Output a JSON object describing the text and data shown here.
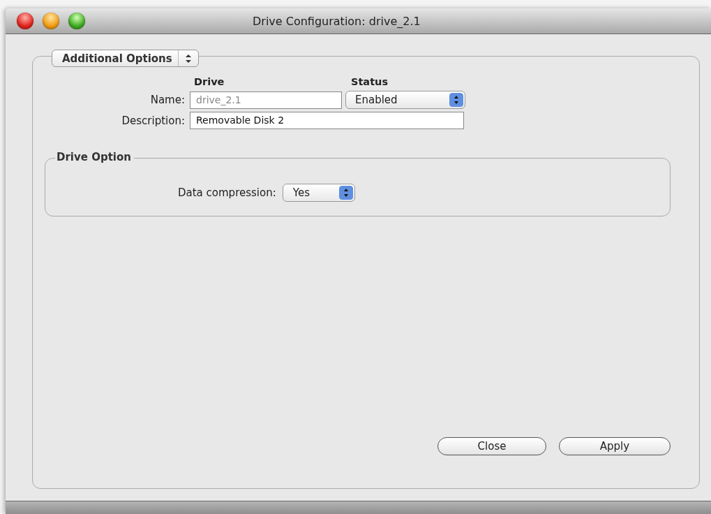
{
  "window": {
    "title": "Drive Configuration: drive_2.1"
  },
  "panel_selector": {
    "value": "Additional Options"
  },
  "columns": [
    "Drive",
    "Status"
  ],
  "name": {
    "label": "Name:",
    "value": "drive_2.1",
    "disabled": true
  },
  "status": {
    "value": "Enabled"
  },
  "description": {
    "label": "Description:",
    "value": "Removable Disk 2",
    "disabled": false
  },
  "drive_option": {
    "title": "Drive Option",
    "data_compression": {
      "label": "Data compression:",
      "value": "Yes"
    }
  },
  "buttons": [
    "Close",
    "Apply"
  ]
}
